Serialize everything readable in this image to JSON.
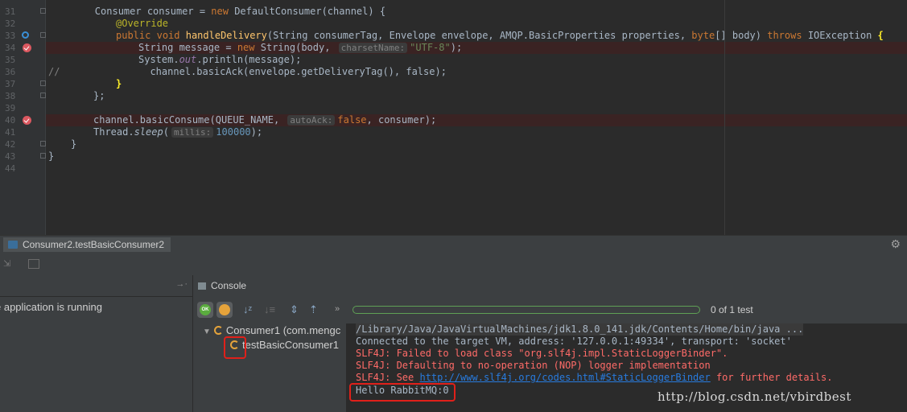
{
  "editor": {
    "line_numbers": [
      "31",
      "32",
      "33",
      "34",
      "35",
      "36",
      "37",
      "38",
      "39",
      "40",
      "41",
      "42",
      "43",
      "44"
    ],
    "l31": {
      "a": "        Consumer consumer = ",
      "kw": "new",
      "b": " DefaultConsumer(channel) {"
    },
    "l32": {
      "ann": "@Override"
    },
    "l33": {
      "kw1": "public",
      "kw2": "void",
      "fn": "handleDelivery",
      "a": "(String consumerTag, Envelope envelope, AMQP.BasicProperties properties, ",
      "kw3": "byte",
      "b": "[] body) ",
      "kw4": "throws",
      "c": " IOException ",
      "brace": "{"
    },
    "l34": {
      "a": "String message = ",
      "kw": "new",
      "b": " String(body, ",
      "hint": "charsetName:",
      "str": "\"UTF-8\"",
      "c": ");"
    },
    "l35": {
      "a": "System.",
      "it": "out",
      "b": ".println(message);"
    },
    "l36": {
      "cm": "//",
      "a": "channel.basicAck(envelope.getDeliveryTag(), ",
      "kw": "false",
      "b": ");"
    },
    "l37": {
      "brace": "}"
    },
    "l38": {
      "a": "};"
    },
    "l40": {
      "a": "channel.basicConsume(QUEUE_NAME, ",
      "hint": "autoAck:",
      "kw": "false",
      "b": ", consumer);"
    },
    "l41": {
      "a": "Thread.",
      "st": "sleep",
      "b": "(",
      "hint": "millis:",
      "num": "100000",
      "c": ");"
    },
    "l42": {
      "a": "}"
    },
    "l43": {
      "a": "}"
    }
  },
  "run": {
    "tab_label": "Consumer2.testBasicConsumer2",
    "status_text": "e application is running",
    "console_tab": "Console",
    "progress_fraction": 0.0,
    "test_count": "0 of 1 test",
    "tree": {
      "root": "Consumer1 (com.mengc",
      "child": "testBasicConsumer1"
    },
    "console_lines": {
      "l1": "/Library/Java/JavaVirtualMachines/jdk1.8.0_141.jdk/Contents/Home/bin/java ...",
      "l2": "Connected to the target VM, address: '127.0.0.1:49334', transport: 'socket'",
      "l3": "SLF4J: Failed to load class \"org.slf4j.impl.StaticLoggerBinder\".",
      "l4": "SLF4J: Defaulting to no-operation (NOP) logger implementation",
      "l5a": "SLF4J: See ",
      "l5link": "http://www.slf4j.org/codes.html#StaticLoggerBinder",
      "l5b": " for further details.",
      "l6": "Hello RabbitMQ:0"
    }
  },
  "watermark": "http://blog.csdn.net/vbirdbest",
  "colors": {
    "keyword": "#cc7832",
    "string": "#6a8759",
    "error": "#ff6b68",
    "highlight": "#e0201a"
  }
}
